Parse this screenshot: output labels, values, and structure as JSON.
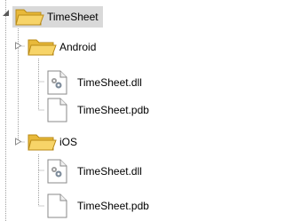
{
  "tree": {
    "root": {
      "label": "TimeSheet",
      "icon": "folder-icon",
      "selected": true,
      "expanded": true,
      "children": [
        {
          "label": "Android",
          "icon": "folder-icon",
          "expanded": true,
          "children": [
            {
              "label": "TimeSheet.dll",
              "icon": "dll-file-icon"
            },
            {
              "label": "TimeSheet.pdb",
              "icon": "blank-file-icon"
            }
          ]
        },
        {
          "label": "iOS",
          "icon": "folder-icon",
          "expanded": true,
          "children": [
            {
              "label": "TimeSheet.dll",
              "icon": "dll-file-icon"
            },
            {
              "label": "TimeSheet.pdb",
              "icon": "blank-file-icon"
            }
          ]
        }
      ]
    }
  },
  "colors": {
    "selection": "#d9d9d9",
    "folder_fill": "#f7d468",
    "folder_edge": "#b98a17",
    "file_edge": "#8a8a8a",
    "tree_line": "#a0a0a0"
  }
}
